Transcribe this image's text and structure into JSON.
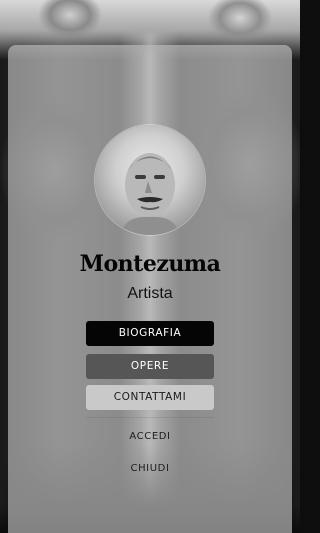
{
  "profile": {
    "name": "Montezuma",
    "role": "Artista"
  },
  "menu": {
    "biografia_label": "BIOGRAFIA",
    "opere_label": "OPERE",
    "contattami_label": "CONTATTAMI"
  },
  "links": {
    "accedi_label": "ACCEDI",
    "chiudi_label": "CHIUDI"
  },
  "colors": {
    "primary_button": "#050505",
    "secondary_button": "#565656",
    "tertiary_button": "#c9c9c9",
    "card_background": "#b2b2b2"
  },
  "icons": {
    "avatar": "profile-photo"
  }
}
